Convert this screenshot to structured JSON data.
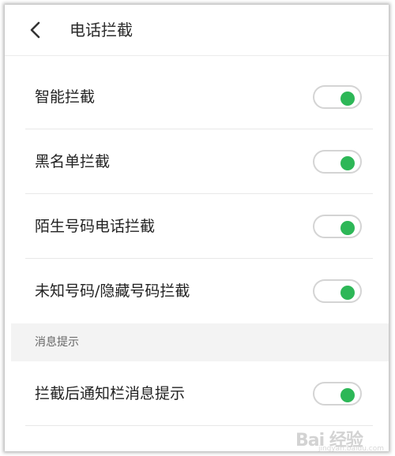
{
  "header": {
    "title": "电话拦截",
    "back_icon": "chevron-left-icon"
  },
  "settings": [
    {
      "label": "智能拦截",
      "enabled": true
    },
    {
      "label": "黑名单拦截",
      "enabled": true
    },
    {
      "label": "陌生号码电话拦截",
      "enabled": true
    },
    {
      "label": "未知号码/隐藏号码拦截",
      "enabled": true
    }
  ],
  "notification_section": {
    "title": "消息提示",
    "items": [
      {
        "label": "拦截后通知栏消息提示",
        "enabled": true
      }
    ]
  },
  "colors": {
    "toggle_on": "#2db757",
    "toggle_border": "#d4d4d4",
    "section_bg": "#f3f3f3",
    "divider": "#e8e8e8"
  },
  "watermark": {
    "text": "Bai 经验",
    "sub": "jingyan.baidu.com"
  }
}
